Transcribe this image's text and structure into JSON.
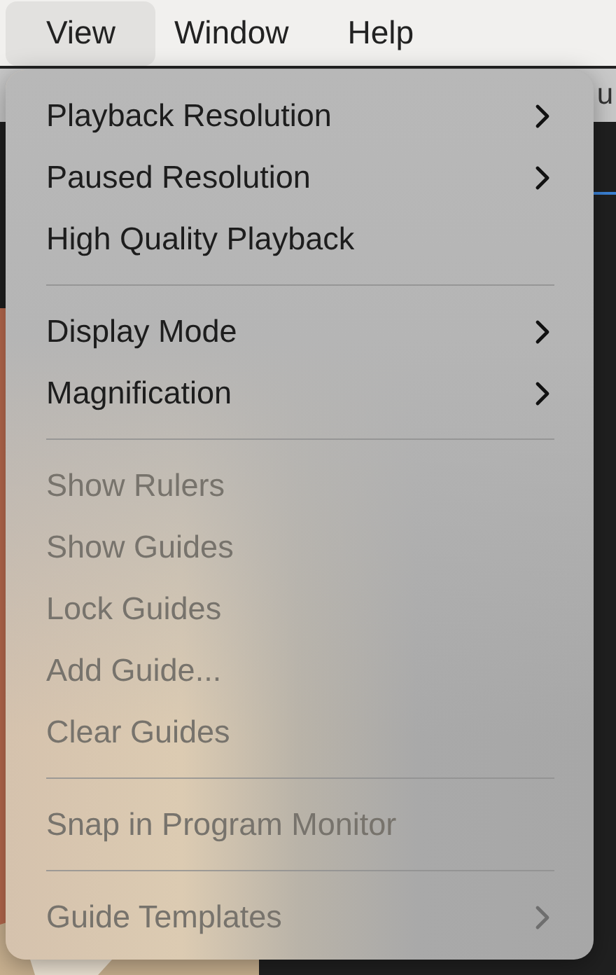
{
  "menu_bar": [
    {
      "label": "View",
      "selected": true
    },
    {
      "label": "Window",
      "selected": false
    },
    {
      "label": "Help",
      "selected": false
    }
  ],
  "background_text": "u",
  "menu": {
    "items": [
      {
        "kind": "item",
        "label": "Playback Resolution",
        "disabled": false,
        "submenu": true
      },
      {
        "kind": "item",
        "label": "Paused Resolution",
        "disabled": false,
        "submenu": true
      },
      {
        "kind": "item",
        "label": "High Quality Playback",
        "disabled": false,
        "submenu": false
      },
      {
        "kind": "separator"
      },
      {
        "kind": "item",
        "label": "Display Mode",
        "disabled": false,
        "submenu": true
      },
      {
        "kind": "item",
        "label": "Magnification",
        "disabled": false,
        "submenu": true
      },
      {
        "kind": "separator"
      },
      {
        "kind": "item",
        "label": "Show Rulers",
        "disabled": true,
        "submenu": false
      },
      {
        "kind": "item",
        "label": "Show Guides",
        "disabled": true,
        "submenu": false
      },
      {
        "kind": "item",
        "label": "Lock Guides",
        "disabled": true,
        "submenu": false
      },
      {
        "kind": "item",
        "label": "Add Guide...",
        "disabled": true,
        "submenu": false
      },
      {
        "kind": "item",
        "label": "Clear Guides",
        "disabled": true,
        "submenu": false
      },
      {
        "kind": "separator"
      },
      {
        "kind": "item",
        "label": "Snap in Program Monitor",
        "disabled": true,
        "submenu": false
      },
      {
        "kind": "separator"
      },
      {
        "kind": "item",
        "label": "Guide Templates",
        "disabled": true,
        "submenu": true
      }
    ]
  }
}
